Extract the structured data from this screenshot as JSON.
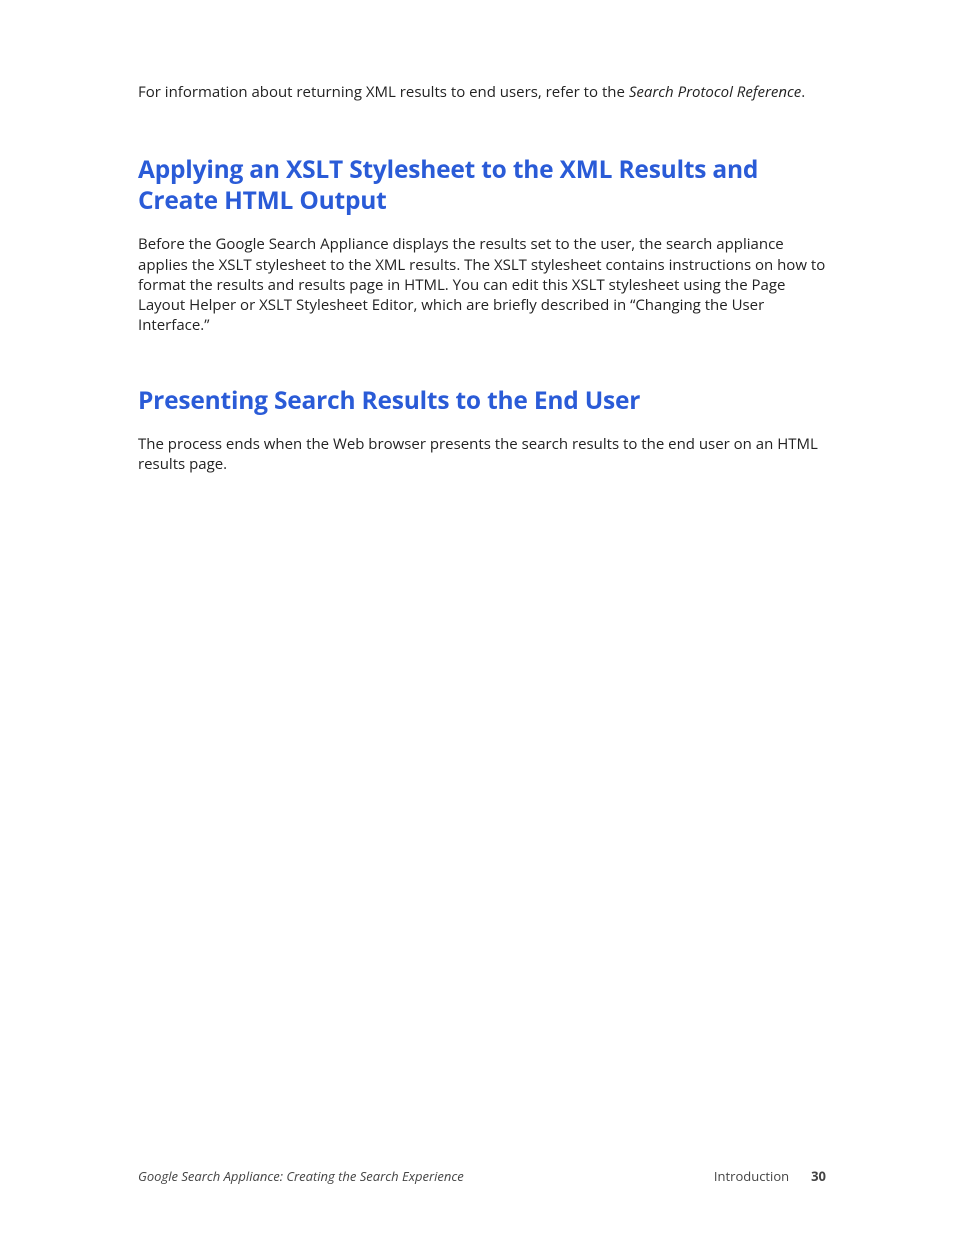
{
  "intro": {
    "prefix": "For information about returning XML results to end users, refer to the ",
    "reference": "Search Protocol Reference",
    "suffix": "."
  },
  "section1": {
    "heading": "Applying an XSLT Stylesheet to the XML Results and Create HTML Output",
    "body": "Before the Google Search Appliance displays the results set to the user, the search appliance applies the XSLT stylesheet to the XML results. The XSLT stylesheet contains instructions on how to format the results and results page in HTML. You can edit this XSLT stylesheet using the Page Layout Helper or XSLT Stylesheet Editor, which are briefly described in “Changing the User Interface.”"
  },
  "section2": {
    "heading": "Presenting Search Results to the End User",
    "body": "The process ends when the Web browser presents the search results to the end user on an HTML results page."
  },
  "footer": {
    "doc_title": "Google Search Appliance: Creating the Search Experience",
    "chapter": "Introduction",
    "page": "30"
  }
}
